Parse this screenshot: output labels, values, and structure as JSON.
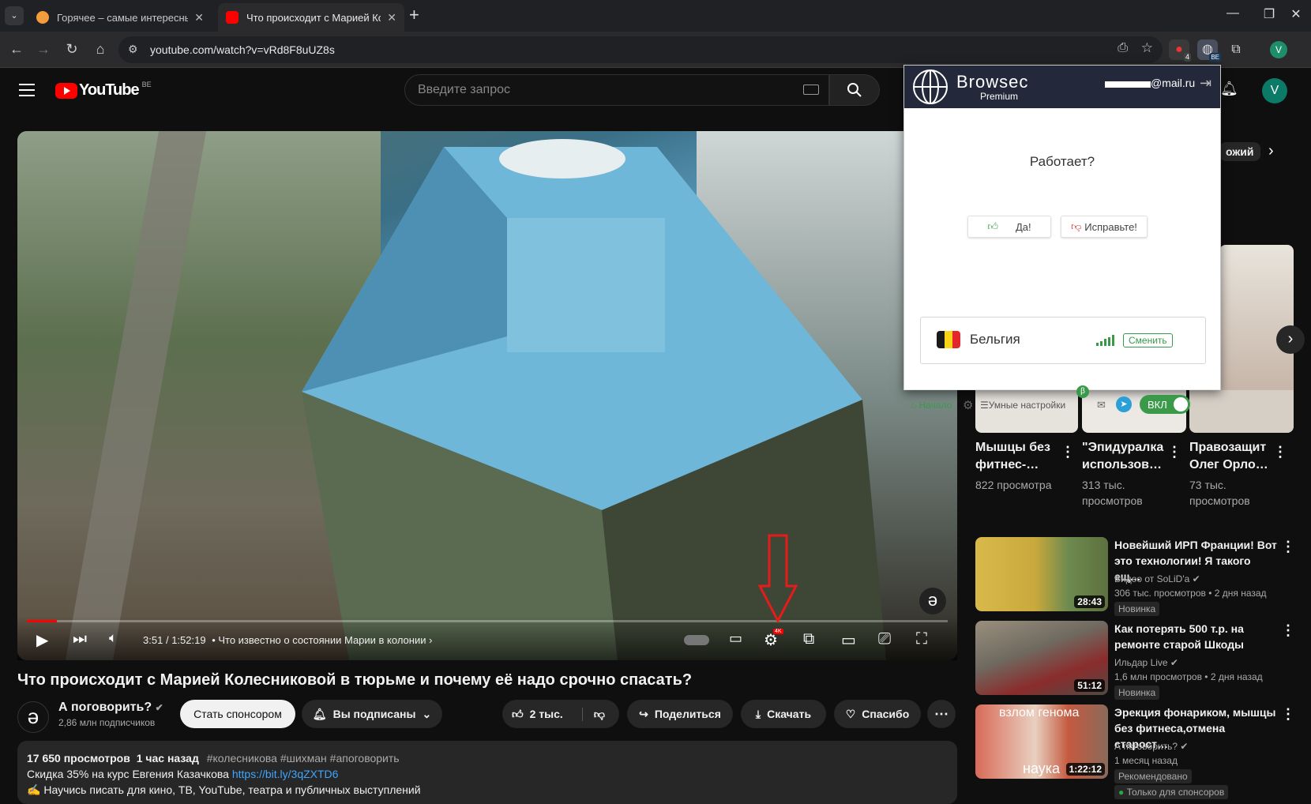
{
  "browser": {
    "tabs": [
      {
        "title": "Горячее – самые интересные",
        "active": false,
        "favicon_color": "#f39c3d"
      },
      {
        "title": "Что происходит с Марией Кол",
        "active": true,
        "favicon_color": "#ff0000"
      }
    ],
    "new_tab": "+",
    "url": "youtube.com/watch?v=vRd8F8uUZ8s",
    "ext_badge_1": "4",
    "ext_badge_2": "BE",
    "profile_initial": "V"
  },
  "youtube": {
    "logo_text": "YouTube",
    "logo_country": "BE",
    "search_placeholder": "Введите запрос",
    "profile_initial": "V"
  },
  "player": {
    "time_current": "3:51",
    "time_total": "1:52:19",
    "time_separator": "/",
    "chapter": "• Что известно о состоянии Марии в колонии",
    "progress_fraction": 0.033,
    "quality_badge": "4K"
  },
  "video": {
    "title": "Что происходит с Марией Колесниковой в тюрьме и почему её надо срочно спасать?",
    "channel": "А поговорить?",
    "subscribers": "2,86 млн подписчиков",
    "sponsor_label": "Стать спонсором",
    "subscribed_label": "Вы подписаны",
    "likes": "2 тыс.",
    "share_label": "Поделиться",
    "download_label": "Скачать",
    "thanks_label": "Спасибо",
    "views": "17 650 просмотров",
    "posted": "1 час назад",
    "hashtags": "#колесникова #шихман #апоговорить",
    "desc_line1": "Скидка 35% на курс Евгения Казачкова",
    "desc_link": "https://bit.ly/3qZXTD6",
    "desc_line2": "Научись писать для кино, ТВ, YouTube, театра и публичных выступлений"
  },
  "sidebar": {
    "chip_partial": "ожий",
    "shorts": [
      {
        "title": "Мышцы без фитнес-…",
        "views": "822 просмотра"
      },
      {
        "title": "\"Эпидуралка использов…",
        "views": "313 тыс. просмотров"
      },
      {
        "title": "Правозащит Олег Орло…",
        "views": "73 тыс. просмотров"
      }
    ],
    "recommendations": [
      {
        "title": "Новейший ИРП Франции! Вот это технологии! Я такого ещ…",
        "channel": "Видео от SoLiD'a",
        "stats": "306 тыс. просмотров • 2 дня назад",
        "badge": "Новинка",
        "duration": "28:43"
      },
      {
        "title": "Как потерять 500 т.р. на ремонте старой Шкоды",
        "channel": "Ильдар Live",
        "stats": "1,6 млн просмотров • 2 дня назад",
        "badge": "Новинка",
        "duration": "51:12"
      },
      {
        "title": "Эрекция фонариком, мышцы без фитнеса,отмена старост…",
        "channel": "А поговорить?",
        "stats": "1 месяц назад",
        "badge": "Рекомендовано",
        "duration": "1:22:12",
        "thumb_text_top": "взлом генома",
        "thumb_text_bottom": "наука"
      }
    ],
    "partial_label": "Только для спонсоров"
  },
  "browsec": {
    "brand": "Browsec",
    "plan": "Premium",
    "email": "@mail.ru",
    "question": "Работает?",
    "yes_label": "Да!",
    "fix_label": "Исправьте!",
    "country": "Бельгия",
    "change_label": "Сменить",
    "home_label": "Начало",
    "smart_label": "Умные настройки",
    "beta_badge": "β",
    "toggle_label": "ВКЛ",
    "accent": "#3a9a4a"
  }
}
